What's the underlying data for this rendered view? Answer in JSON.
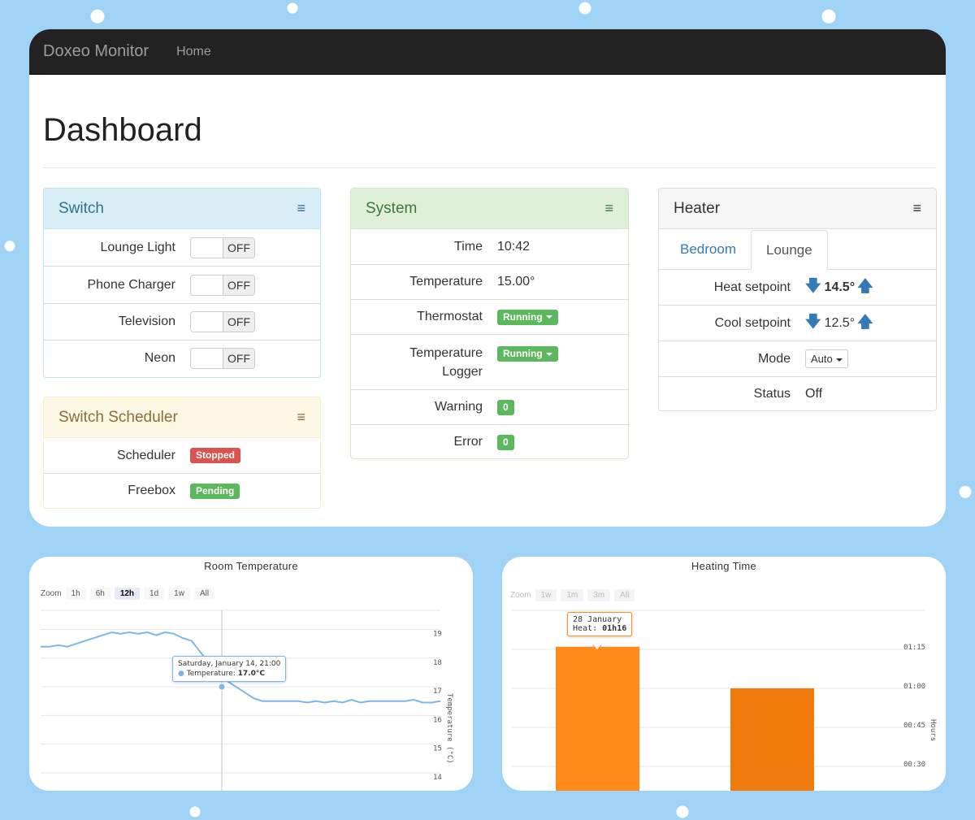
{
  "navbar": {
    "brand": "Doxeo Monitor",
    "home": "Home"
  },
  "page": {
    "title": "Dashboard"
  },
  "menu_glyph": "≡",
  "switch_panel": {
    "title": "Switch",
    "items": [
      {
        "label": "Lounge Light",
        "state": "OFF"
      },
      {
        "label": "Phone Charger",
        "state": "OFF"
      },
      {
        "label": "Television",
        "state": "OFF"
      },
      {
        "label": "Neon",
        "state": "OFF"
      }
    ]
  },
  "scheduler_panel": {
    "title": "Switch Scheduler",
    "items": [
      {
        "label": "Scheduler",
        "status": "Stopped",
        "color": "#d9534f"
      },
      {
        "label": "Freebox",
        "status": "Pending",
        "color": "#5cb85c"
      }
    ]
  },
  "system_panel": {
    "title": "System",
    "time_label": "Time",
    "time_value": "10:42",
    "temp_label": "Temperature",
    "temp_value": "15.00°",
    "thermostat_label": "Thermostat",
    "thermostat_status": "Running",
    "logger_label_1": "Temperature",
    "logger_label_2": "Logger",
    "logger_status": "Running",
    "warning_label": "Warning",
    "warning_count": "0",
    "error_label": "Error",
    "error_count": "0"
  },
  "heater_panel": {
    "title": "Heater",
    "tabs": [
      "Bedroom",
      "Lounge"
    ],
    "active_tab": "Lounge",
    "heat_label": "Heat setpoint",
    "heat_value": "14.5°",
    "cool_label": "Cool setpoint",
    "cool_value": "12.5°",
    "mode_label": "Mode",
    "mode_value": "Auto",
    "status_label": "Status",
    "status_value": "Off",
    "arrow_down": "🡇",
    "arrow_up": "🡅"
  },
  "room_temp_chart": {
    "title": "Room Temperature",
    "zoom_label": "Zoom",
    "zoom_buttons": [
      "1h",
      "6h",
      "12h",
      "1d",
      "1w",
      "All"
    ],
    "zoom_selected": "12h",
    "tooltip_date": "Saturday, January 14, 21:00",
    "tooltip_series": "Temperature:",
    "tooltip_value": "17.0°C"
  },
  "heating_chart": {
    "title": "Heating Time",
    "zoom_label": "Zoom",
    "zoom_buttons": [
      "1w",
      "1m",
      "3m",
      "All"
    ],
    "tooltip_date": "28 January",
    "tooltip_series": "Heat:",
    "tooltip_value": "01h16"
  },
  "chart_data": [
    {
      "type": "line",
      "title": "Room Temperature",
      "ylabel": "Temperature (°C)",
      "ylim": [
        14,
        19.5
      ],
      "yticks": [
        14,
        15,
        16,
        17,
        18,
        19
      ],
      "series": [
        {
          "name": "Temperature",
          "color": "#7cb5ec",
          "values": [
            18.4,
            18.4,
            18.45,
            18.4,
            18.5,
            18.6,
            18.7,
            18.8,
            18.9,
            18.85,
            18.9,
            18.85,
            18.9,
            18.8,
            18.9,
            18.85,
            18.7,
            18.6,
            18.2,
            17.8,
            17.5,
            17.2,
            17.0,
            16.8,
            16.6,
            16.5,
            16.5,
            16.5,
            16.5,
            16.5,
            16.45,
            16.5,
            16.45,
            16.5,
            16.45,
            16.55,
            16.45,
            16.5,
            16.5,
            16.5,
            16.5,
            16.5,
            16.55,
            16.45,
            16.45,
            16.5
          ]
        }
      ],
      "highlight_index": 22
    },
    {
      "type": "bar",
      "title": "Heating Time",
      "ylabel": "Hours",
      "yticks": [
        "00:30",
        "00:45",
        "01:00",
        "01:15"
      ],
      "ylim_minutes": [
        20,
        85
      ],
      "categories": [
        "28 January",
        ""
      ],
      "values_minutes": [
        76,
        60
      ],
      "colors": [
        "#ff8c1a",
        "#f07b0c"
      ]
    }
  ]
}
